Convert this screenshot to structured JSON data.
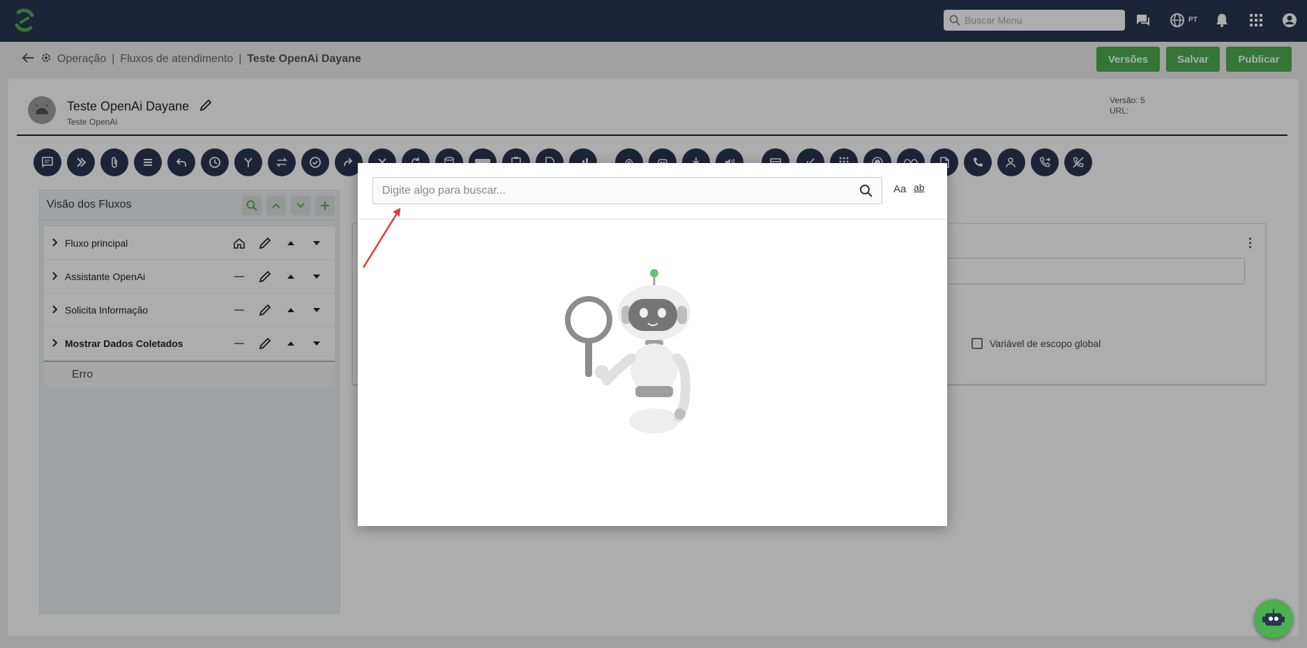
{
  "header": {
    "search_placeholder": "Buscar Menu",
    "lang": "PT",
    "icons": [
      "app-logo",
      "chat-icon",
      "globe-icon",
      "bell-icon",
      "apps-grid-icon",
      "account-icon"
    ]
  },
  "breadcrumb": {
    "items": [
      "Operação",
      "Fluxos de atendimento",
      "Teste OpenAi Dayane"
    ],
    "separator": "|"
  },
  "actions": {
    "versions": "Versões",
    "save": "Salvar",
    "publish": "Publicar"
  },
  "flow": {
    "title": "Teste OpenAi Dayane",
    "subtitle": "Teste OpenAi",
    "version_label": "Versão: 5",
    "url_label": "URL:"
  },
  "flows_panel": {
    "title": "Visão dos Fluxos",
    "rows": [
      {
        "label": "Fluxo principal",
        "home": true,
        "bold": false
      },
      {
        "label": "Assistante OpenAi",
        "home": false,
        "bold": false
      },
      {
        "label": "Solicita Informação",
        "home": false,
        "bold": false
      },
      {
        "label": "Mostrar Dados Coletados",
        "home": false,
        "bold": true
      }
    ],
    "sub_item": "Erro"
  },
  "right_panel": {
    "global_var_label": "Variável de escopo global"
  },
  "modal": {
    "search_placeholder": "Digite algo para buscar...",
    "match_case": "Aa",
    "whole_word": "ab"
  },
  "colors": {
    "topbar": "#2b3551",
    "accent": "#4caf50",
    "annotation_arrow": "#e53935"
  }
}
